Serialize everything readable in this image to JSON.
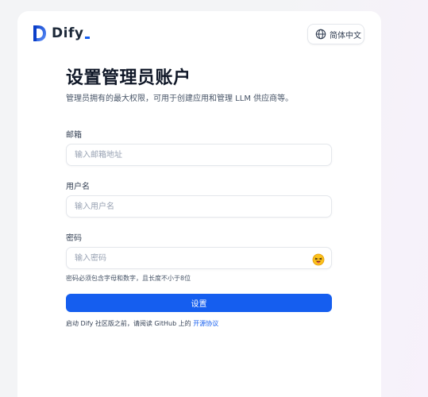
{
  "header": {
    "logo_text": "Dify",
    "language_button": "简体中文",
    "language_icon": "globe-icon"
  },
  "form": {
    "title": "设置管理员账户",
    "subtitle": "管理员拥有的最大权限，可用于创建应用和管理 LLM 供应商等。",
    "email": {
      "label": "邮箱",
      "placeholder": "输入邮箱地址",
      "value": ""
    },
    "username": {
      "label": "用户名",
      "placeholder": "输入用户名",
      "value": ""
    },
    "password": {
      "label": "密码",
      "placeholder": "输入密码",
      "value": "",
      "toggle_icon": "face-emoji-icon"
    },
    "password_hint": "密码必须包含字母和数字，且长度不小于8位",
    "submit_label": "设置"
  },
  "footer": {
    "text": "启动 Dify 社区版之前，请阅读 GitHub 上的",
    "link_text": "开源协议"
  },
  "colors": {
    "primary": "#155eef",
    "title": "#101828",
    "muted": "#475467",
    "border": "#e4e7ec"
  }
}
